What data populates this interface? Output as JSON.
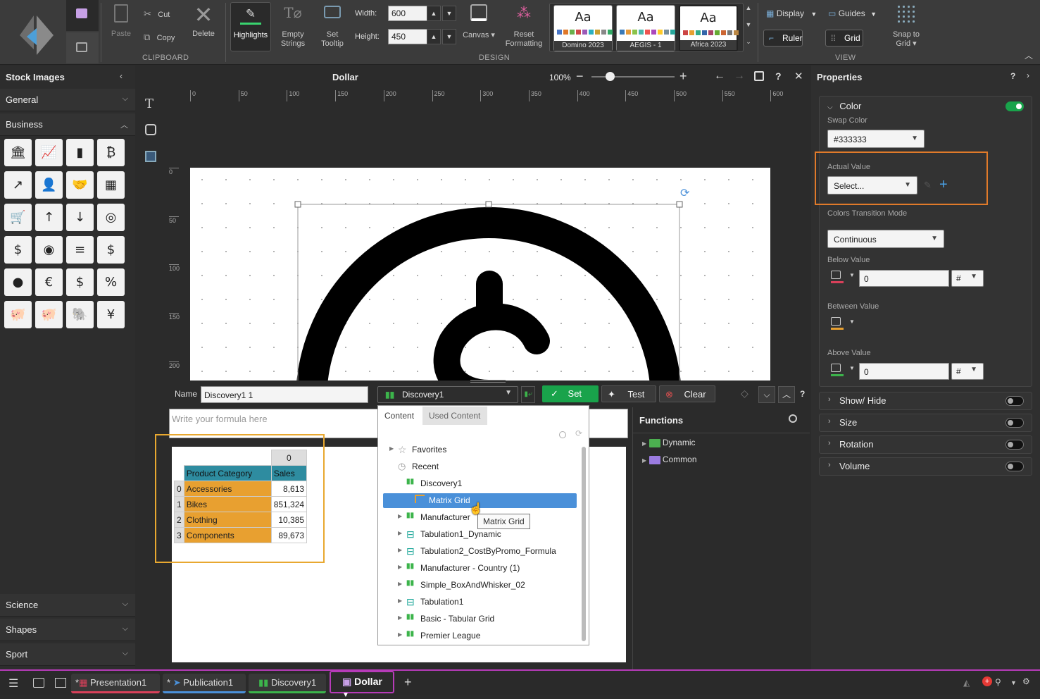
{
  "ribbon": {
    "paste": "Paste",
    "cut": "Cut",
    "copy": "Copy",
    "delete": "Delete",
    "clipboard_group": "CLIPBOARD",
    "highlights": "Highlights",
    "empty_strings": "Empty Strings",
    "set_tooltip": "Set Tooltip",
    "width_label": "Width:",
    "width_value": "600",
    "height_label": "Height:",
    "height_value": "450",
    "canvas": "Canvas",
    "reset_formatting": "Reset Formatting",
    "design_group": "DESIGN",
    "themes": [
      {
        "name": "Domino 2023",
        "glyph": "Aa"
      },
      {
        "name": "AEGIS - 1",
        "glyph": "Aa"
      },
      {
        "name": "Africa 2023",
        "glyph": "Aa"
      }
    ],
    "display": "Display",
    "guides": "Guides",
    "ruler": "Ruler",
    "grid": "Grid",
    "snap_to_grid": "Snap to Grid",
    "view_group": "VIEW"
  },
  "left_panel": {
    "title": "Stock Images",
    "sections": [
      "General",
      "Business",
      "Science",
      "Shapes",
      "Sport"
    ],
    "icons": [
      "bank-icon",
      "chart-up-icon",
      "bar-chart-icon",
      "bitcoin-icon",
      "growth-chart-icon",
      "businessman-icon",
      "handshake-icon",
      "calculator-icon",
      "cart-icon",
      "growth-arrow-icon",
      "decline-arrow-icon",
      "coin-stack-icon",
      "money-icon",
      "coins-icon",
      "stack-icon",
      "dollar-circle-icon",
      "dollar-coin-icon",
      "euro-icon",
      "money-bag-icon",
      "percent-icon",
      "piggy-bank-icon",
      "piggy-icon",
      "elephant-icon",
      "yen-icon"
    ]
  },
  "editor": {
    "title": "Dollar",
    "zoom": "100%",
    "ruler_ticks": [
      "0",
      "50",
      "100",
      "150",
      "200",
      "250",
      "300",
      "350",
      "400",
      "450",
      "500",
      "550",
      "600"
    ],
    "vruler_ticks": [
      "0",
      "50",
      "100",
      "150",
      "200"
    ]
  },
  "formula": {
    "name_label": "Name",
    "name_value": "Discovery1 1",
    "source_select": "Discovery1",
    "set": "Set",
    "test": "Test",
    "clear": "Clear",
    "placeholder": "Write your formula here",
    "functions_title": "Functions",
    "functions": [
      "Dynamic",
      "Common"
    ],
    "tabs": [
      "Content",
      "Used Content"
    ],
    "tree": [
      "Favorites",
      "Recent",
      "Discovery1",
      "Matrix Grid",
      "Manufacturer",
      "Tabulation1_Dynamic",
      "Tabulation2_CostByPromo_Formula",
      "Manufacturer - Country (1)",
      "Simple_BoxAndWhisker_02",
      "Tabulation1",
      "Basic - Tabular Grid",
      "Premier League"
    ],
    "tooltip": "Matrix Grid",
    "table": {
      "col_index": "0",
      "headers": [
        "Product Category",
        "Sales"
      ],
      "rows": [
        {
          "i": "0",
          "cat": "Accessories",
          "val": "8,613"
        },
        {
          "i": "1",
          "cat": "Bikes",
          "val": "851,324"
        },
        {
          "i": "2",
          "cat": "Clothing",
          "val": "10,385"
        },
        {
          "i": "3",
          "cat": "Components",
          "val": "89,673"
        }
      ]
    }
  },
  "properties": {
    "title": "Properties",
    "color_section": "Color",
    "swap_color_label": "Swap Color",
    "swap_color_value": "#333333",
    "actual_value_label": "Actual Value",
    "actual_value": "Select...",
    "transition_label": "Colors Transition Mode",
    "transition_value": "Continuous",
    "below_label": "Below Value",
    "below_value": "0",
    "between_label": "Between Value",
    "above_label": "Above Value",
    "above_value": "0",
    "hash": "#",
    "sections": [
      "Show/ Hide",
      "Size",
      "Rotation",
      "Volume"
    ]
  },
  "taskbar": {
    "tabs": [
      "Presentation1",
      "Publication1",
      "Discovery1",
      "Dollar"
    ],
    "modified_mark": "*"
  },
  "colors": {
    "accent_green": "#19a34b",
    "highlight_orange": "#e08a2a",
    "select_blue": "#4a90d9"
  }
}
